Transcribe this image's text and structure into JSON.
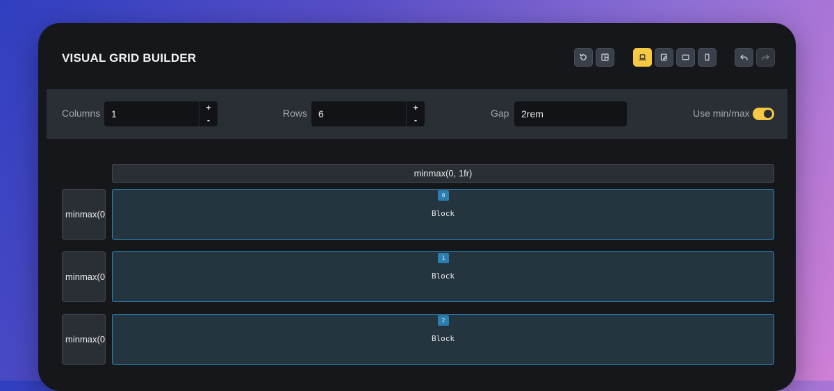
{
  "app": {
    "title": "VISUAL GRID BUILDER"
  },
  "toolbar": {
    "buttons": [
      {
        "icon": "reset-icon"
      },
      {
        "icon": "layout-icon"
      },
      {
        "icon": "laptop-icon",
        "active": true
      },
      {
        "icon": "tablet-edit-icon"
      },
      {
        "icon": "tablet-landscape-icon"
      },
      {
        "icon": "mobile-icon"
      },
      {
        "icon": "undo-icon"
      },
      {
        "icon": "redo-icon"
      }
    ]
  },
  "controls": {
    "columns": {
      "label": "Columns",
      "value": "1",
      "plus": "+",
      "minus": "-"
    },
    "rows": {
      "label": "Rows",
      "value": "6",
      "plus": "+",
      "minus": "-"
    },
    "gap": {
      "label": "Gap",
      "value": "2rem"
    },
    "minmax": {
      "label": "Use min/max",
      "enabled": true
    }
  },
  "grid": {
    "column_headers": [
      "minmax(0, 1fr)"
    ],
    "row_headers": [
      "minmax(0",
      "minmax(0",
      "minmax(0"
    ],
    "blocks": [
      {
        "index": "0",
        "label": "Block"
      },
      {
        "index": "1",
        "label": "Block"
      },
      {
        "index": "2",
        "label": "Block"
      }
    ]
  },
  "colors": {
    "accent": "#f7c844",
    "block_border": "#2f8ec4",
    "block_bg": "#243540",
    "window_bg": "#15171b"
  }
}
